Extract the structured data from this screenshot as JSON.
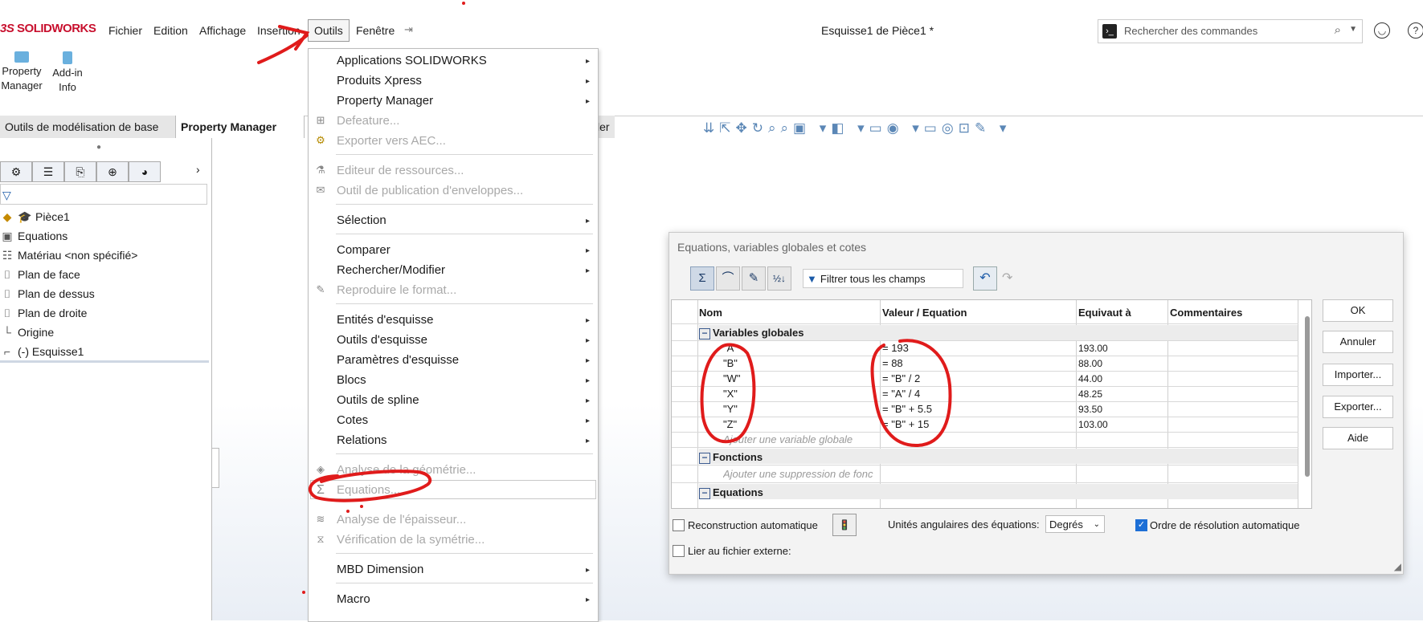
{
  "app": {
    "brand": "SOLIDWORKS",
    "document_title": "Esquisse1 de Pièce1 *",
    "menus": [
      "Fichier",
      "Edition",
      "Affichage",
      "Insertion",
      "Outils",
      "Fenêtre"
    ],
    "active_menu": "Outils",
    "search_placeholder": "Rechercher des commandes"
  },
  "command_manager": {
    "buttons": [
      "Property Manager",
      "Add-in Info"
    ],
    "tabs": [
      "Outils de modélisation de base",
      "Property Manager"
    ],
    "hidden_tab_suffix": "ler"
  },
  "feature_tree": {
    "items": [
      "Pièce1",
      "Equations",
      "Matériau <non spécifié>",
      "Plan de face",
      "Plan de dessus",
      "Plan de droite",
      "Origine",
      "(-) Esquisse1"
    ]
  },
  "tools_menu": {
    "items": [
      {
        "label": "Applications SOLIDWORKS",
        "enabled": true,
        "submenu": true
      },
      {
        "label": "Produits Xpress",
        "enabled": true,
        "submenu": true
      },
      {
        "label": "Property Manager",
        "enabled": true,
        "submenu": true
      },
      {
        "label": "Defeature...",
        "enabled": false,
        "submenu": false
      },
      {
        "label": "Exporter vers AEC...",
        "enabled": false,
        "submenu": false
      },
      {
        "label": "Editeur de ressources...",
        "enabled": false,
        "submenu": false
      },
      {
        "label": "Outil de publication d'enveloppes...",
        "enabled": false,
        "submenu": false
      },
      {
        "label": "Sélection",
        "enabled": true,
        "submenu": true
      },
      {
        "label": "Comparer",
        "enabled": true,
        "submenu": true
      },
      {
        "label": "Rechercher/Modifier",
        "enabled": true,
        "submenu": true
      },
      {
        "label": "Reproduire le format...",
        "enabled": false,
        "submenu": false
      },
      {
        "label": "Entités d'esquisse",
        "enabled": true,
        "submenu": true
      },
      {
        "label": "Outils d'esquisse",
        "enabled": true,
        "submenu": true
      },
      {
        "label": "Paramètres d'esquisse",
        "enabled": true,
        "submenu": true
      },
      {
        "label": "Blocs",
        "enabled": true,
        "submenu": true
      },
      {
        "label": "Outils de spline",
        "enabled": true,
        "submenu": true
      },
      {
        "label": "Cotes",
        "enabled": true,
        "submenu": true
      },
      {
        "label": "Relations",
        "enabled": true,
        "submenu": true
      },
      {
        "label": "Analyse de la géométrie...",
        "enabled": false,
        "submenu": false
      },
      {
        "label": "Equations...",
        "enabled": false,
        "submenu": false
      },
      {
        "label": "Analyse de l'épaisseur...",
        "enabled": false,
        "submenu": false
      },
      {
        "label": "Vérification de la symétrie...",
        "enabled": false,
        "submenu": false
      },
      {
        "label": "MBD Dimension",
        "enabled": true,
        "submenu": true
      },
      {
        "label": "Macro",
        "enabled": true,
        "submenu": true
      }
    ]
  },
  "equations_dialog": {
    "title": "Equations, variables globales et cotes",
    "filter_placeholder": "Filtrer tous les champs",
    "columns": [
      "Nom",
      "Valeur / Equation",
      "Equivaut à",
      "Commentaires"
    ],
    "sections": {
      "globals": "Variables globales",
      "functions": "Fonctions",
      "equations": "Equations"
    },
    "globals": [
      {
        "name": "\"A\"",
        "equation": "= 193",
        "value": "193.00"
      },
      {
        "name": "\"B\"",
        "equation": "= 88",
        "value": "88.00"
      },
      {
        "name": "\"W\"",
        "equation": "= \"B\" / 2",
        "value": "44.00"
      },
      {
        "name": "\"X\"",
        "equation": "= \"A\" / 4",
        "value": "48.25"
      },
      {
        "name": "\"Y\"",
        "equation": "= \"B\" + 5.5",
        "value": "93.50"
      },
      {
        "name": "\"Z\"",
        "equation": "= \"B\" + 15",
        "value": "103.00"
      }
    ],
    "add_global_hint": "Ajouter une variable globale",
    "add_suppression_hint": "Ajouter une suppression de fonc",
    "buttons": [
      "OK",
      "Annuler",
      "Importer...",
      "Exporter...",
      "Aide"
    ],
    "auto_rebuild_label": "Reconstruction automatique",
    "auto_rebuild": false,
    "units_label": "Unités angulaires des équations:",
    "units_value": "Degrés",
    "auto_order_label": "Ordre de résolution automatique",
    "auto_order": true,
    "link_external_label": "Lier au fichier externe:",
    "link_external": false
  },
  "colors": {
    "brand_red": "#c8102e",
    "annotation_red": "#e01b1b",
    "accent_blue": "#1d6fd6"
  }
}
